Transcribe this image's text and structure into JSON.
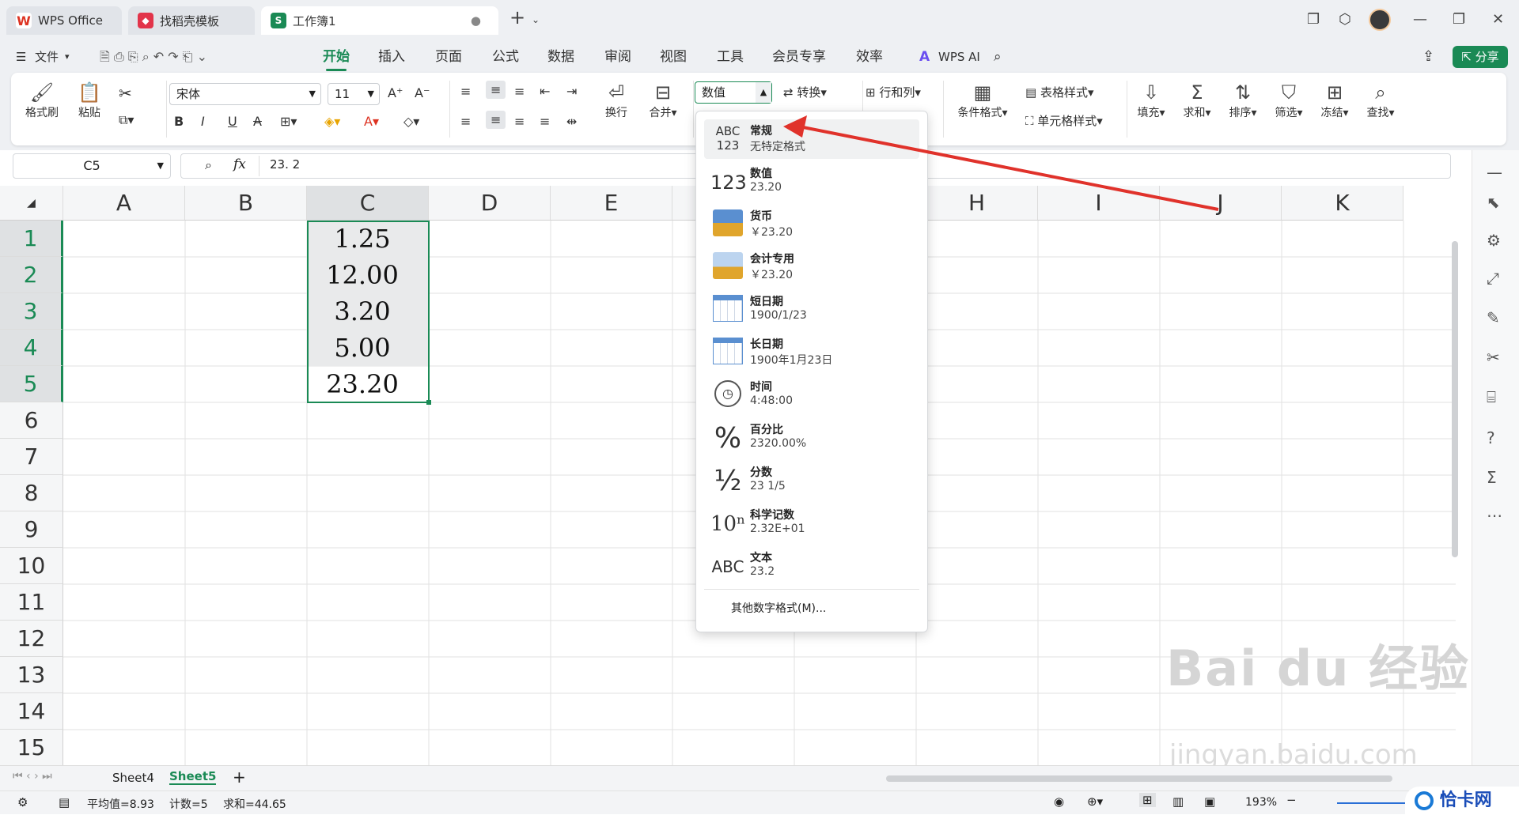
{
  "tabs": [
    {
      "label": "WPS Office",
      "icon": "wps-logo-icon"
    },
    {
      "label": "找稻壳模板",
      "icon": "docer-icon"
    },
    {
      "label": "工作簿1",
      "icon": "spreadsheet-icon"
    }
  ],
  "menu": {
    "file": "文件",
    "items": [
      "开始",
      "插入",
      "页面",
      "公式",
      "数据",
      "审阅",
      "视图",
      "工具",
      "会员专享",
      "效率"
    ],
    "active": "开始",
    "ai": "WPS AI",
    "share": "分享"
  },
  "ribbon": {
    "format_painter": "格式刷",
    "paste": "粘贴",
    "font_name": "宋体",
    "font_size": "11",
    "wrap": "换行",
    "merge": "合并",
    "number_format": "数值",
    "convert": "转换",
    "row_col": "行和列",
    "table_style": "表格样式",
    "cond_format": "条件格式",
    "cell_style": "单元格样式",
    "fill": "填充",
    "sum": "求和",
    "sort": "排序",
    "filter": "筛选",
    "freeze": "冻结",
    "find": "查找"
  },
  "formula_bar": {
    "cell_ref": "C5",
    "fx": "fx",
    "value": "23. 2"
  },
  "columns": [
    "A",
    "B",
    "C",
    "D",
    "E",
    "F",
    "G",
    "H",
    "I",
    "J",
    "K"
  ],
  "rows": [
    "1",
    "2",
    "3",
    "4",
    "5",
    "6",
    "7",
    "8",
    "9",
    "10",
    "11",
    "12",
    "13",
    "14",
    "15"
  ],
  "cells_c": [
    "1.25",
    "12.00",
    "3.20",
    "5.00",
    "23.20"
  ],
  "dropdown": [
    {
      "name": "常规",
      "sample": "无特定格式",
      "icon": "abc-123-icon",
      "glyph": "ABC\n123"
    },
    {
      "name": "数值",
      "sample": "23.20",
      "icon": "number-123-icon",
      "glyph": "123"
    },
    {
      "name": "货币",
      "sample": "￥23.20",
      "icon": "currency-coins-icon",
      "glyph": "💰"
    },
    {
      "name": "会计专用",
      "sample": " ￥23.20",
      "icon": "accounting-icon",
      "glyph": "🧮"
    },
    {
      "name": "短日期",
      "sample": "1900/1/23",
      "icon": "calendar-short-icon",
      "glyph": "📅"
    },
    {
      "name": "长日期",
      "sample": "1900年1月23日",
      "icon": "calendar-long-icon",
      "glyph": "📆"
    },
    {
      "name": "时间",
      "sample": "4:48:00",
      "icon": "clock-icon",
      "glyph": "🕓"
    },
    {
      "name": "百分比",
      "sample": "2320.00%",
      "icon": "percent-icon",
      "glyph": "%"
    },
    {
      "name": "分数",
      "sample": "23 1/5",
      "icon": "fraction-icon",
      "glyph": "½"
    },
    {
      "name": "科学记数",
      "sample": "2.32E+01",
      "icon": "scientific-icon",
      "glyph": "10ⁿ"
    },
    {
      "name": "文本",
      "sample": "23.2",
      "icon": "text-abc-icon",
      "glyph": "ABC"
    }
  ],
  "dropdown_more": "其他数字格式(M)...",
  "sheets": [
    "Sheet4",
    "Sheet5"
  ],
  "active_sheet": "Sheet5",
  "status": {
    "avg": "平均值=8.93",
    "count": "计数=5",
    "sum": "求和=44.65",
    "zoom": "193%"
  },
  "watermark": {
    "brand": "Bai du 经验",
    "url": "jingyan.baidu.com",
    "corner": "恰卡网"
  },
  "colors": {
    "accent": "#1a8a55",
    "arrow": "#e0322b"
  }
}
